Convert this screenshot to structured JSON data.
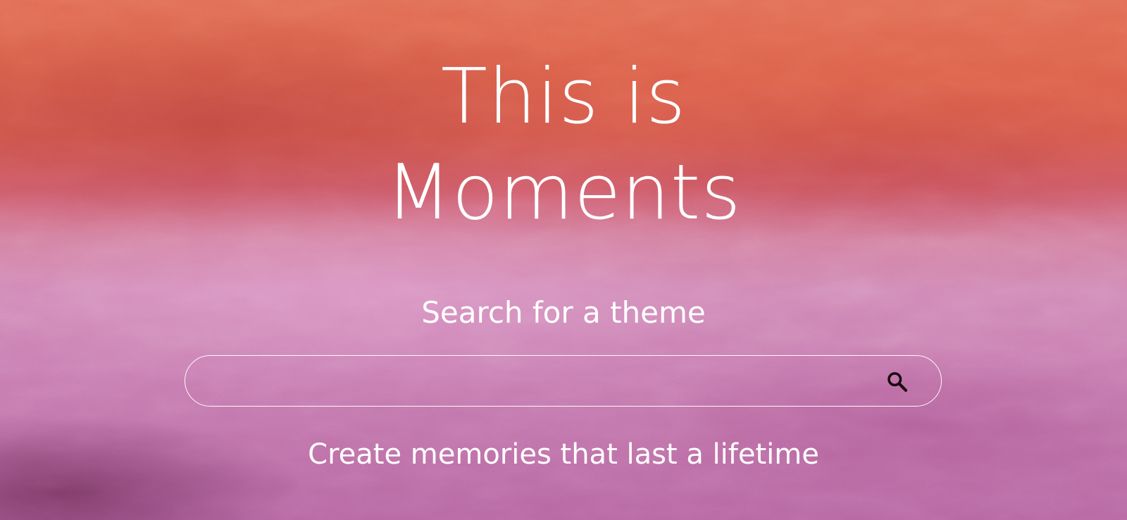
{
  "hero": {
    "title_line1": "This is",
    "title_line2": "Moments",
    "background_top_color": "#e06a52",
    "background_bottom_color": "#b4639e"
  },
  "search": {
    "label": "Search for a theme",
    "value": "",
    "placeholder": "",
    "button_icon": "search-icon",
    "icon_color": "#1a0a12"
  },
  "tagline": "Create memories that last a lifetime"
}
